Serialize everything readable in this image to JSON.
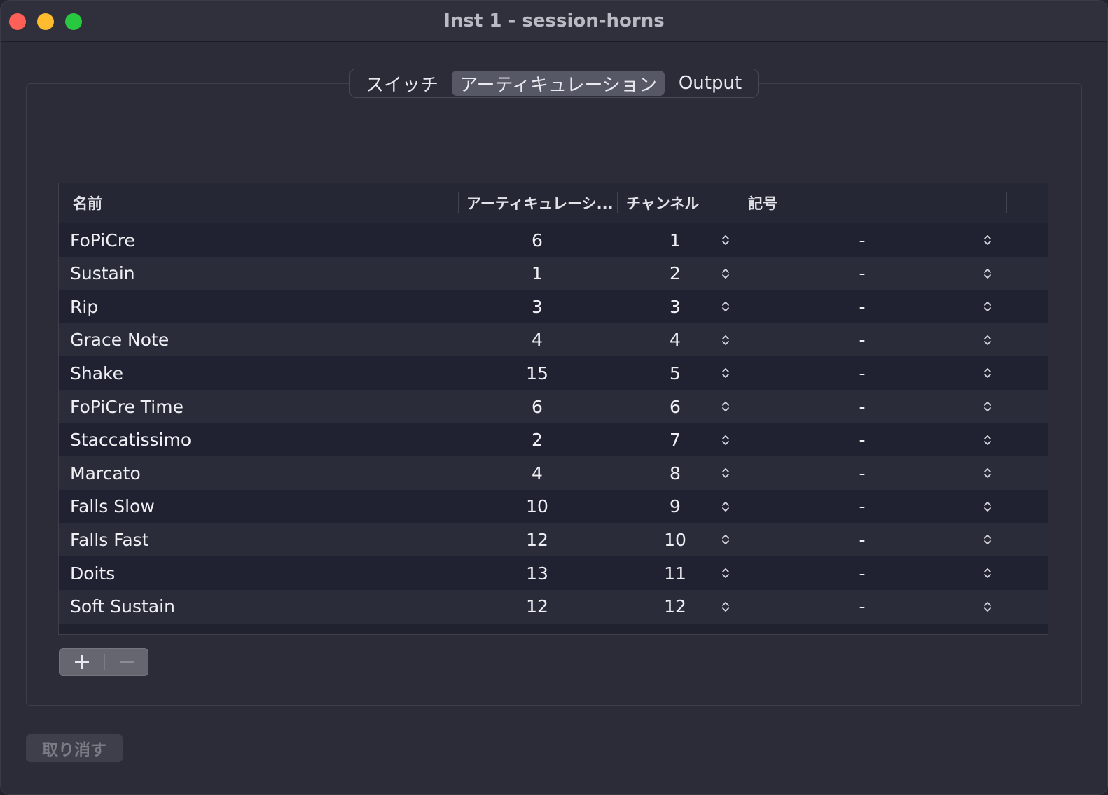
{
  "window": {
    "title": "Inst 1 - session-horns"
  },
  "tabs": [
    {
      "label": "スイッチ",
      "active": false
    },
    {
      "label": "アーティキュレーション",
      "active": true
    },
    {
      "label": "Output",
      "active": false
    }
  ],
  "table": {
    "columns": {
      "name": "名前",
      "articulation": "アーティキュレーシ...",
      "channel": "チャンネル",
      "symbol": "記号"
    },
    "rows": [
      {
        "name": "FoPiCre",
        "articulation": "6",
        "channel": "1",
        "symbol": "-"
      },
      {
        "name": "Sustain",
        "articulation": "1",
        "channel": "2",
        "symbol": "-"
      },
      {
        "name": "Rip",
        "articulation": "3",
        "channel": "3",
        "symbol": "-"
      },
      {
        "name": "Grace Note",
        "articulation": "4",
        "channel": "4",
        "symbol": "-"
      },
      {
        "name": "Shake",
        "articulation": "15",
        "channel": "5",
        "symbol": "-"
      },
      {
        "name": "FoPiCre Time",
        "articulation": "6",
        "channel": "6",
        "symbol": "-"
      },
      {
        "name": "Staccatissimo",
        "articulation": "2",
        "channel": "7",
        "symbol": "-"
      },
      {
        "name": "Marcato",
        "articulation": "4",
        "channel": "8",
        "symbol": "-"
      },
      {
        "name": "Falls Slow",
        "articulation": "10",
        "channel": "9",
        "symbol": "-"
      },
      {
        "name": "Falls Fast",
        "articulation": "12",
        "channel": "10",
        "symbol": "-"
      },
      {
        "name": "Doits",
        "articulation": "13",
        "channel": "11",
        "symbol": "-"
      },
      {
        "name": "Soft Sustain",
        "articulation": "12",
        "channel": "12",
        "symbol": "-"
      }
    ]
  },
  "footer": {
    "undo_label": "取り消す"
  },
  "icons": {
    "add": "plus-icon",
    "remove": "minus-icon",
    "stepper": "up-down-chevron-icon"
  },
  "colors": {
    "close": "#fe5f57",
    "minimize": "#febc2e",
    "maximize": "#28c840",
    "active_tab": "#575866"
  }
}
